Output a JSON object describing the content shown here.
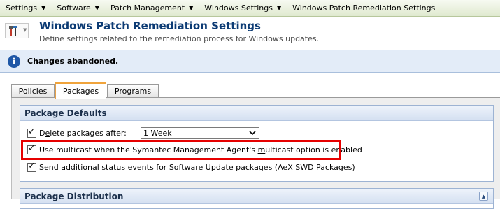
{
  "breadcrumb": [
    {
      "label": "Settings",
      "has_menu": true
    },
    {
      "label": "Software",
      "has_menu": true
    },
    {
      "label": "Patch Management",
      "has_menu": true
    },
    {
      "label": "Windows Settings",
      "has_menu": true
    },
    {
      "label": "Windows Patch Remediation Settings",
      "has_menu": false
    }
  ],
  "header": {
    "icon": "tools-icon",
    "title": "Windows Patch Remediation Settings",
    "subtitle": "Define settings related to the remediation process for Windows updates."
  },
  "message": {
    "icon": "info-icon",
    "text": "Changes abandoned."
  },
  "tabs": [
    {
      "label": "Policies",
      "active": false
    },
    {
      "label": "Packages",
      "active": true
    },
    {
      "label": "Programs",
      "active": false
    }
  ],
  "package_defaults": {
    "title": "Package Defaults",
    "delete_packages": {
      "checked": true,
      "label_pre": "D",
      "label_ul": "e",
      "label_post": "lete packages after:",
      "select_value": "1 Week"
    },
    "use_multicast": {
      "checked": true,
      "label_pre": "Use multicast when the Symantec Management Agent's ",
      "label_ul": "m",
      "label_post": "ulticast option is enabled"
    },
    "send_status": {
      "checked": true,
      "label_pre": "Send additional status ",
      "label_ul": "e",
      "label_post": "vents for Software Update packages (AeX SWD Packages)"
    }
  },
  "package_distribution": {
    "title": "Package Distribution"
  },
  "colors": {
    "title_blue": "#0c3b74",
    "highlight_red": "#e60000",
    "active_tab_orange": "#f0a43c"
  }
}
